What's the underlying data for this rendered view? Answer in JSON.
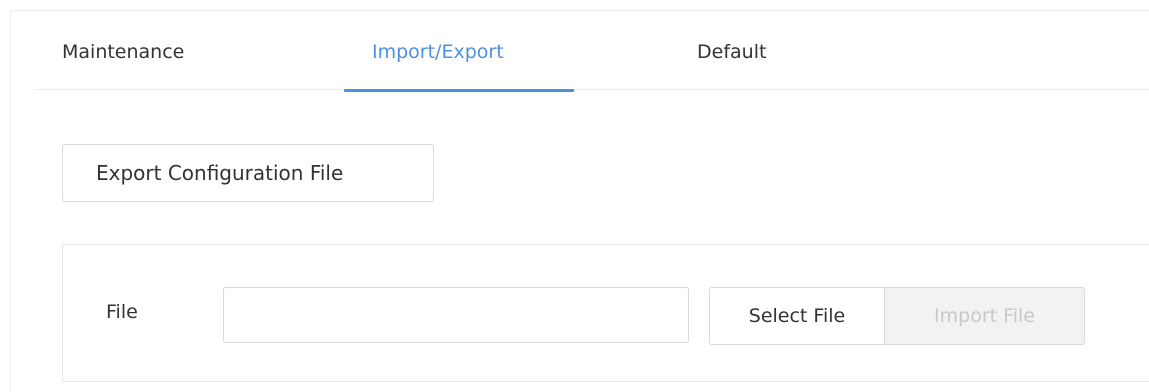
{
  "tabs": {
    "maintenance": "Maintenance",
    "import_export": "Import/Export",
    "default": "Default",
    "active": "import_export",
    "accent_color": "#4f8fe0"
  },
  "export": {
    "button_label": "Export Configuration File"
  },
  "import": {
    "file_label": "File",
    "file_value": "",
    "select_button": "Select File",
    "import_button": "Import File",
    "import_enabled": false
  }
}
